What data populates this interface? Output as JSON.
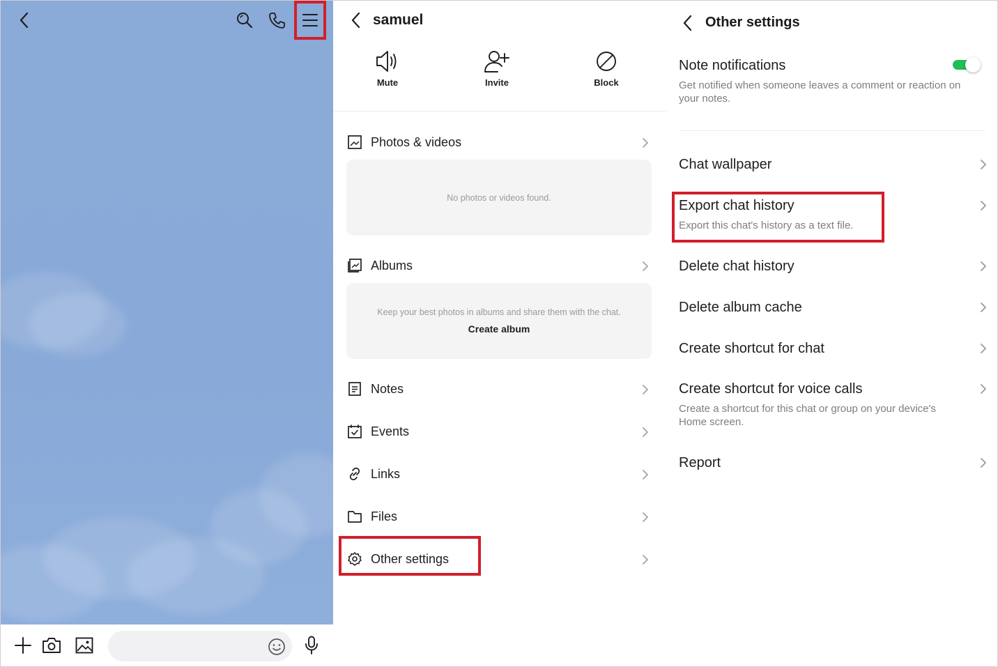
{
  "chat": {
    "back_icon": "chevron-left-icon",
    "search_icon": "search-icon",
    "call_icon": "phone-icon",
    "menu_icon": "hamburger-menu-icon",
    "input_icons": [
      "plus-icon",
      "camera-icon",
      "image-icon",
      "emoji-icon",
      "microphone-icon"
    ],
    "message_placeholder": ""
  },
  "chat_info": {
    "title": "samuel",
    "actions": [
      {
        "label": "Mute",
        "icon": "speaker-icon"
      },
      {
        "label": "Invite",
        "icon": "add-user-icon"
      },
      {
        "label": "Block",
        "icon": "block-icon"
      }
    ],
    "photos": {
      "label": "Photos & videos",
      "empty_text": "No photos or videos found."
    },
    "albums": {
      "label": "Albums",
      "empty_text": "Keep your best photos in albums and share them with the chat.",
      "create_label": "Create album"
    },
    "rows": [
      {
        "label": "Notes",
        "icon": "notes-icon"
      },
      {
        "label": "Events",
        "icon": "calendar-check-icon"
      },
      {
        "label": "Links",
        "icon": "link-icon"
      },
      {
        "label": "Files",
        "icon": "folder-icon"
      },
      {
        "label": "Other settings",
        "icon": "gear-icon"
      }
    ]
  },
  "other_settings": {
    "title": "Other settings",
    "note_notifications": {
      "title": "Note notifications",
      "description": "Get notified when someone leaves a comment or reaction on your notes.",
      "enabled": true
    },
    "items": [
      {
        "title": "Chat wallpaper",
        "description": ""
      },
      {
        "title": "Export chat history",
        "description": "Export this chat's history as a text file."
      },
      {
        "title": "Delete chat history",
        "description": ""
      },
      {
        "title": "Delete album cache",
        "description": ""
      },
      {
        "title": "Create shortcut for chat",
        "description": ""
      },
      {
        "title": "Create shortcut for voice calls",
        "description": "Create a shortcut for this chat or group on your device's Home screen."
      },
      {
        "title": "Report",
        "description": ""
      }
    ]
  },
  "colors": {
    "highlight": "#d11f2b",
    "chat_background": "#8aaad8",
    "toggle_on": "#21bd55"
  }
}
